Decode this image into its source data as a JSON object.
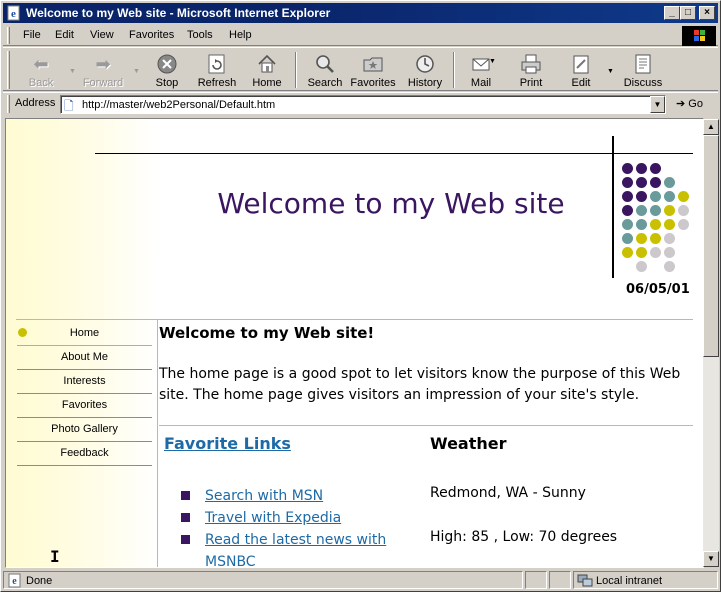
{
  "window": {
    "title": "Welcome to my Web site - Microsoft Internet Explorer",
    "controls": [
      "_",
      "□",
      "×"
    ]
  },
  "menu": [
    "File",
    "Edit",
    "View",
    "Favorites",
    "Tools",
    "Help"
  ],
  "toolbar": {
    "back": "Back",
    "forward": "Forward",
    "stop": "Stop",
    "refresh": "Refresh",
    "home": "Home",
    "search": "Search",
    "favorites": "Favorites",
    "history": "History",
    "mail": "Mail",
    "print": "Print",
    "edit": "Edit",
    "discuss": "Discuss"
  },
  "address": {
    "label": "Address",
    "value": "http://master/web2Personal/Default.htm",
    "go": "Go"
  },
  "page": {
    "heading": "Welcome to my Web site",
    "date": "06/05/01",
    "nav": [
      "Home",
      "About Me",
      "Interests",
      "Favorites",
      "Photo Gallery",
      "Feedback"
    ],
    "welcome_title": "Welcome to my Web site!",
    "intro": "The home page is a good spot to let visitors know the purpose of this Web site. The home page gives visitors an impression of your site's style.",
    "favorites_heading": "Favorite Links",
    "links": [
      "Search with MSN",
      "Travel with Expedia",
      "Read the latest news with MSNBC"
    ],
    "weather_heading": "Weather",
    "weather_location": "Redmond, WA - Sunny",
    "weather_temps": "High: 85 , Low: 70 degrees"
  },
  "status": {
    "text": "Done",
    "zone": "Local intranet"
  },
  "colors": {
    "heading": "#3a1660",
    "link": "#1e6aa6",
    "accent_yellow": "#c8c000",
    "accent_teal": "#6a9a9a",
    "titlebar": "#0a246a"
  }
}
